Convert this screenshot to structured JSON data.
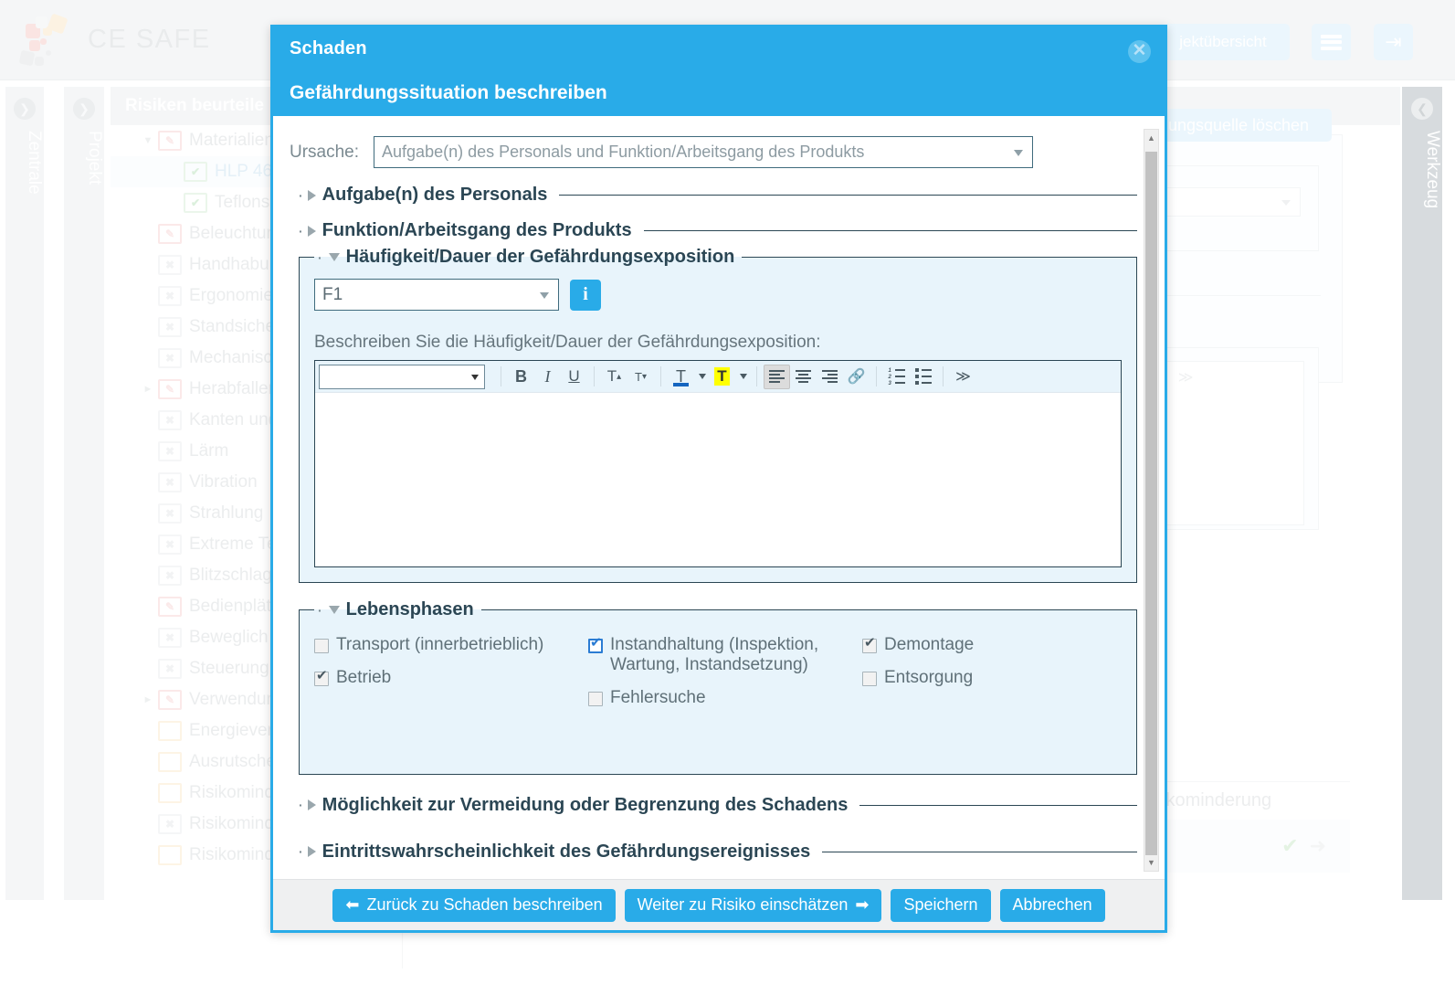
{
  "app": {
    "logo_text": "CE SAFE",
    "top_buttons": [
      {
        "name": "projektuebersicht",
        "label": "jektübersicht"
      },
      {
        "name": "menu",
        "label": ""
      },
      {
        "name": "logout",
        "label": ""
      }
    ],
    "side_tabs": {
      "left": [
        "Zentrale",
        "Projekt"
      ],
      "right": [
        "Werkzeug"
      ]
    },
    "tree": {
      "header": "Risiken beurteile",
      "items": [
        {
          "label": "Materialien",
          "icon": "folder-edit-icon",
          "color": "red",
          "indent": 1,
          "twisty": "down",
          "selected": false
        },
        {
          "label": "HLP 46",
          "icon": "file-check-icon",
          "color": "grn",
          "indent": 2,
          "twisty": "",
          "selected": true
        },
        {
          "label": "Teflonsp",
          "icon": "file-check-icon",
          "color": "grn",
          "indent": 2,
          "twisty": "",
          "selected": false
        },
        {
          "label": "Beleuchtun",
          "icon": "folder-edit-icon",
          "color": "red",
          "indent": 1,
          "twisty": "",
          "selected": false
        },
        {
          "label": "Handhabu",
          "icon": "folder-x-icon",
          "color": "gry",
          "indent": 1,
          "twisty": "",
          "selected": false
        },
        {
          "label": "Ergonomie",
          "icon": "folder-x-icon",
          "color": "gry",
          "indent": 1,
          "twisty": "",
          "selected": false
        },
        {
          "label": "Standsiche",
          "icon": "folder-x-icon",
          "color": "gry",
          "indent": 1,
          "twisty": "",
          "selected": false
        },
        {
          "label": "Mechanisc",
          "icon": "folder-x-icon",
          "color": "gry",
          "indent": 1,
          "twisty": "",
          "selected": false
        },
        {
          "label": "Herabfallen",
          "icon": "folder-edit-icon",
          "color": "red",
          "indent": 1,
          "twisty": "right",
          "selected": false
        },
        {
          "label": "Kanten und",
          "icon": "folder-x-icon",
          "color": "gry",
          "indent": 1,
          "twisty": "",
          "selected": false
        },
        {
          "label": "Lärm",
          "icon": "folder-x-icon",
          "color": "gry",
          "indent": 1,
          "twisty": "",
          "selected": false
        },
        {
          "label": "Vibration",
          "icon": "folder-x-icon",
          "color": "gry",
          "indent": 1,
          "twisty": "",
          "selected": false
        },
        {
          "label": "Strahlung",
          "icon": "folder-x-icon",
          "color": "gry",
          "indent": 1,
          "twisty": "",
          "selected": false
        },
        {
          "label": "Extreme Te",
          "icon": "folder-x-icon",
          "color": "gry",
          "indent": 1,
          "twisty": "",
          "selected": false
        },
        {
          "label": "Blitzschlag",
          "icon": "folder-x-icon",
          "color": "gry",
          "indent": 1,
          "twisty": "",
          "selected": false
        },
        {
          "label": "Bedienplät",
          "icon": "folder-edit-icon",
          "color": "red",
          "indent": 1,
          "twisty": "",
          "selected": false
        },
        {
          "label": "Beweglich",
          "icon": "folder-x-icon",
          "color": "gry",
          "indent": 1,
          "twisty": "",
          "selected": false
        },
        {
          "label": "Steuerung",
          "icon": "folder-x-icon",
          "color": "gry",
          "indent": 1,
          "twisty": "",
          "selected": false
        },
        {
          "label": "Verwendun",
          "icon": "folder-edit-icon",
          "color": "red",
          "indent": 1,
          "twisty": "right",
          "selected": false
        },
        {
          "label": "Energievers",
          "icon": "folder-icon",
          "color": "org",
          "indent": 1,
          "twisty": "",
          "selected": false
        },
        {
          "label": "Ausrutsche",
          "icon": "folder-icon",
          "color": "org",
          "indent": 1,
          "twisty": "",
          "selected": false
        },
        {
          "label": "Risikomind",
          "icon": "folder-icon",
          "color": "org",
          "indent": 1,
          "twisty": "",
          "selected": false
        },
        {
          "label": "Risikomind",
          "icon": "folder-x-icon",
          "color": "gry",
          "indent": 1,
          "twisty": "",
          "selected": false
        },
        {
          "label": "Risikomind",
          "icon": "folder-icon",
          "color": "org",
          "indent": 1,
          "twisty": "",
          "selected": false
        }
      ]
    },
    "main": {
      "delete_button": "hrdungsquelle löschen",
      "table_headers": [
        "g",
        "Risikominderung"
      ]
    }
  },
  "modal": {
    "title": "Schaden",
    "subtitle": "Gefährdungssituation beschreiben",
    "close_label": "✕",
    "ursache": {
      "label": "Ursache:",
      "value": "Aufgabe(n) des Personals und Funktion/Arbeitsgang des Produkts"
    },
    "sections": [
      {
        "name": "aufgaben-des-personals",
        "label": "Aufgabe(n) des Personals",
        "expanded": false
      },
      {
        "name": "funktion-arbeitsgang",
        "label": "Funktion/Arbeitsgang des Produkts",
        "expanded": false
      }
    ],
    "frequency": {
      "legend": "Häufigkeit/Dauer der Gefährdungsexposition",
      "select_value": "F1",
      "info_label": "i",
      "description_label": "Beschreiben Sie die Häufigkeit/Dauer der Gefährdungsexposition:",
      "editor": {
        "format_select_value": "",
        "content": "",
        "buttons": [
          {
            "name": "bold-icon",
            "glyph": "B"
          },
          {
            "name": "italic-icon",
            "glyph": "I"
          },
          {
            "name": "underline-icon",
            "glyph": "U"
          },
          {
            "name": "superscript-icon",
            "glyph": "T"
          },
          {
            "name": "subscript-icon",
            "glyph": "T"
          },
          {
            "name": "font-color-icon",
            "glyph": "T"
          },
          {
            "name": "highlight-icon",
            "glyph": "T"
          },
          {
            "name": "align-left-icon",
            "glyph": ""
          },
          {
            "name": "align-center-icon",
            "glyph": ""
          },
          {
            "name": "align-right-icon",
            "glyph": ""
          },
          {
            "name": "link-icon",
            "glyph": "⌘"
          },
          {
            "name": "ordered-list-icon",
            "glyph": ""
          },
          {
            "name": "unordered-list-icon",
            "glyph": ""
          },
          {
            "name": "source-code-icon",
            "glyph": "≫"
          }
        ]
      }
    },
    "lebensphasen": {
      "legend": "Lebensphasen",
      "items": [
        {
          "label": "Transport (innerbetrieblich)",
          "checked": false,
          "focused": false,
          "col": 1
        },
        {
          "label": "Betrieb",
          "checked": true,
          "focused": false,
          "col": 1
        },
        {
          "label": "Instandhaltung (Inspektion, Wartung, Instandsetzung)",
          "checked": true,
          "focused": true,
          "col": 2
        },
        {
          "label": "Fehlersuche",
          "checked": false,
          "focused": false,
          "col": 2
        },
        {
          "label": "Demontage",
          "checked": true,
          "focused": false,
          "col": 3
        },
        {
          "label": "Entsorgung",
          "checked": false,
          "focused": false,
          "col": 3
        }
      ]
    },
    "collapsed_sections": [
      {
        "name": "moeglichkeit-vermeidung",
        "label": "Möglichkeit zur Vermeidung oder Begrenzung des Schadens"
      },
      {
        "name": "eintrittswahrscheinlichkeit",
        "label": "Eintrittswahrscheinlichkeit des Gefährdungsereignisses"
      }
    ],
    "footer": {
      "back": "Zurück zu Schaden beschreiben",
      "next": "Weiter zu Risiko einschätzen",
      "save": "Speichern",
      "cancel": "Abbrechen"
    }
  },
  "colors": {
    "accent": "#29abe8",
    "panel_bg": "#e8f4fb",
    "border_dark": "#2b4654",
    "highlight_yellow": "#ffff00"
  }
}
